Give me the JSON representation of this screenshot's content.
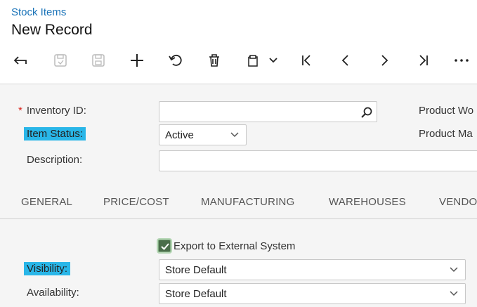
{
  "header": {
    "breadcrumb": "Stock Items",
    "title": "New Record"
  },
  "toolbar": {
    "buttons": [
      "undo-arrow-icon",
      "save-close-icon",
      "save-icon",
      "add-icon",
      "cancel-icon",
      "delete-icon",
      "copy-paste-icon",
      "chevron-down-icon",
      "first-record-icon",
      "previous-record-icon",
      "next-record-icon",
      "last-record-icon",
      "more-icon"
    ]
  },
  "form": {
    "inventory_id_label": "Inventory ID:",
    "required_marker": "*",
    "inventory_id_value": "",
    "item_status_label": "Item Status:",
    "item_status_value": "Active",
    "description_label": "Description:",
    "description_value": "",
    "product_workgroup_label": "Product Wo",
    "product_manager_label": "Product Ma"
  },
  "tabs": [
    "GENERAL",
    "PRICE/COST",
    "MANUFACTURING",
    "WAREHOUSES",
    "VENDO"
  ],
  "general": {
    "export_label": "Export to External System",
    "export_checked": true,
    "visibility_label": "Visibility:",
    "visibility_value": "Store Default",
    "availability_label": "Availability:",
    "availability_value": "Store Default"
  },
  "colors": {
    "link": "#1a73b8",
    "highlight": "#29b6e8",
    "required": "#d9251d",
    "panel": "#f5f5f5"
  }
}
